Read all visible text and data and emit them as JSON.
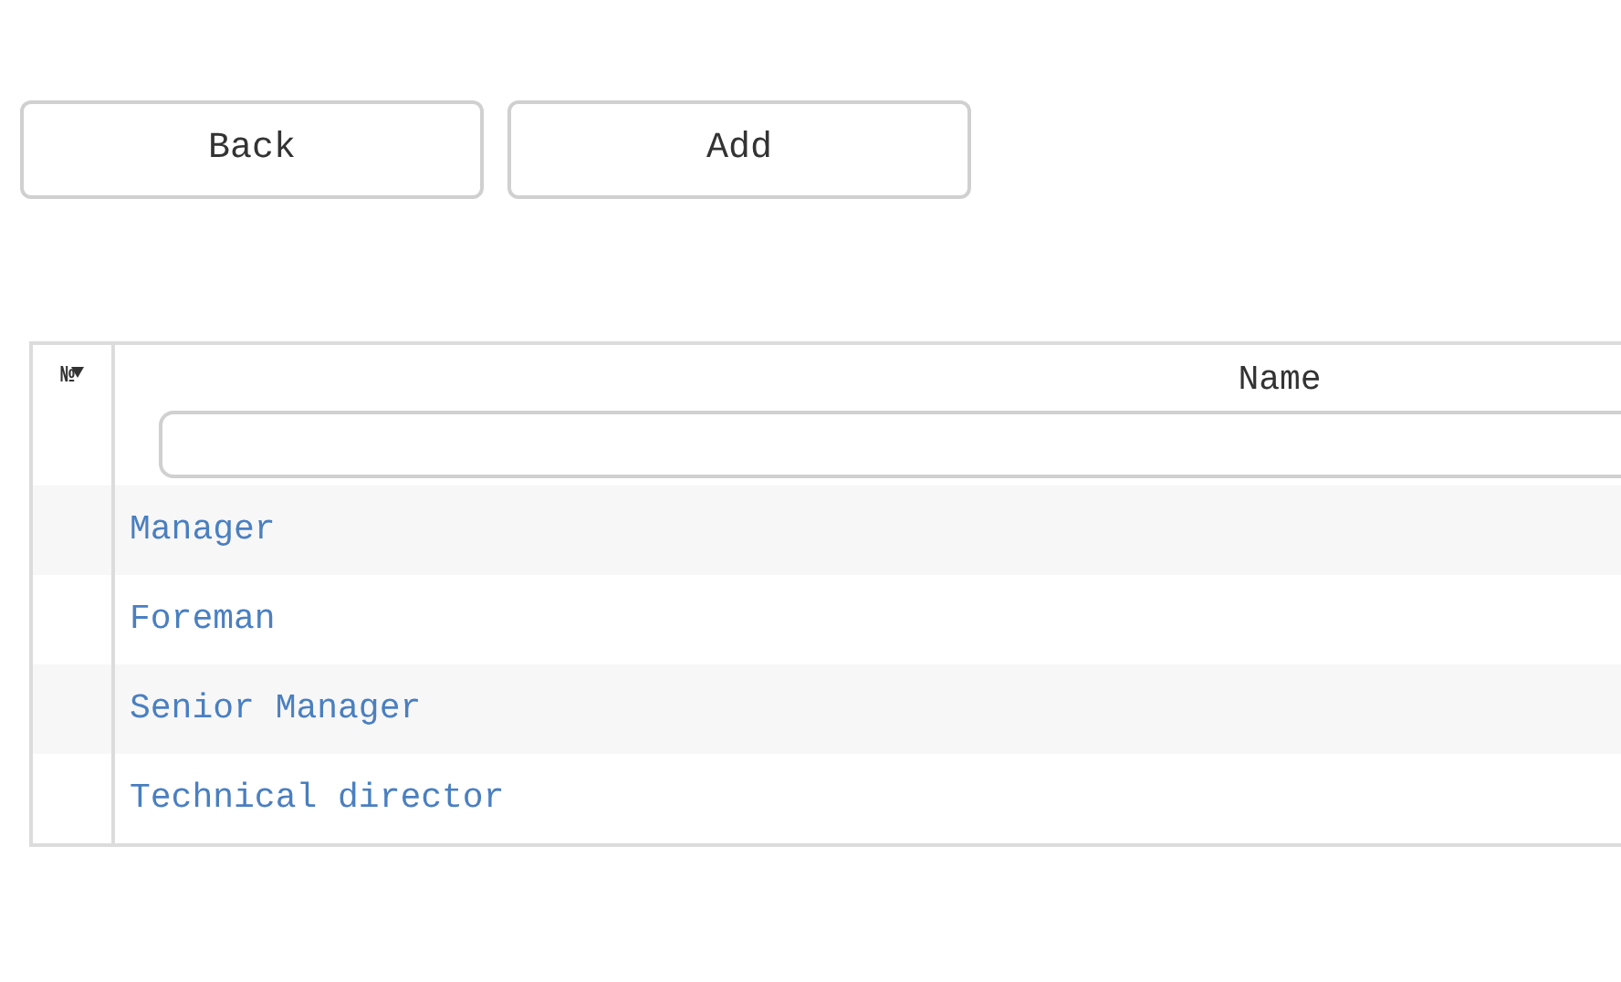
{
  "buttons": [
    {
      "label": "Back"
    },
    {
      "label": "Add"
    }
  ],
  "table": {
    "columns": [
      {
        "label": "№"
      },
      {
        "label": "Name"
      }
    ],
    "rows": [
      {
        "name": "Manager"
      },
      {
        "name": "Foreman"
      },
      {
        "name": "Senior Manager"
      },
      {
        "name": "Technical director"
      }
    ]
  }
}
